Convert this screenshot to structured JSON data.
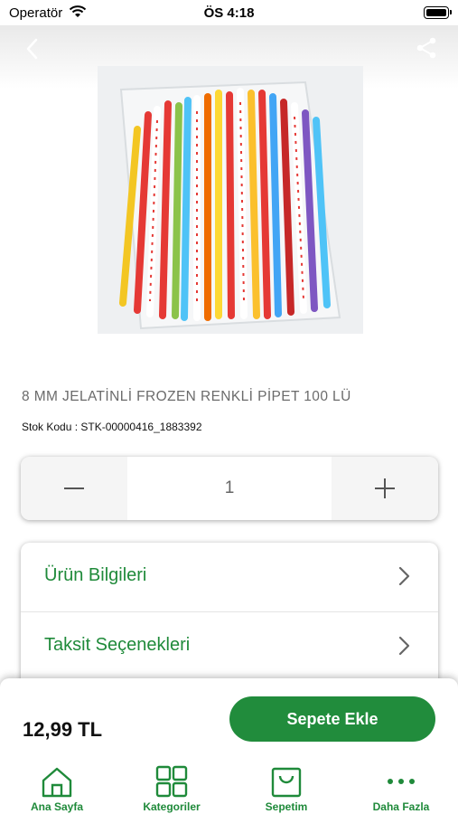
{
  "status_bar": {
    "carrier": "Operatör",
    "time": "ÖS 4:18"
  },
  "header": {
    "back_icon": "chevron-left-icon",
    "share_icon": "share-icon"
  },
  "product": {
    "image_description": "Pack of colorful drinking straws",
    "title": "8 MM JELATİNLİ FROZEN RENKLİ PİPET 100 LÜ",
    "sku": "Stok Kodu : STK-00000416_1883392"
  },
  "quantity": {
    "value": "1"
  },
  "info_sections": [
    {
      "label": "Ürün Bilgileri"
    },
    {
      "label": "Taksit Seçenekleri"
    }
  ],
  "price_bar": {
    "price": "12,99 TL",
    "add_to_cart_label": "Sepete Ekle"
  },
  "tab_bar": {
    "items": [
      {
        "label": "Ana Sayfa",
        "icon": "home-icon"
      },
      {
        "label": "Kategoriler",
        "icon": "grid-icon"
      },
      {
        "label": "Sepetim",
        "icon": "bag-icon"
      },
      {
        "label": "Daha Fazla",
        "icon": "more-icon"
      }
    ]
  },
  "colors": {
    "accent": "#218c3c",
    "label_green": "#1f8a3a"
  }
}
